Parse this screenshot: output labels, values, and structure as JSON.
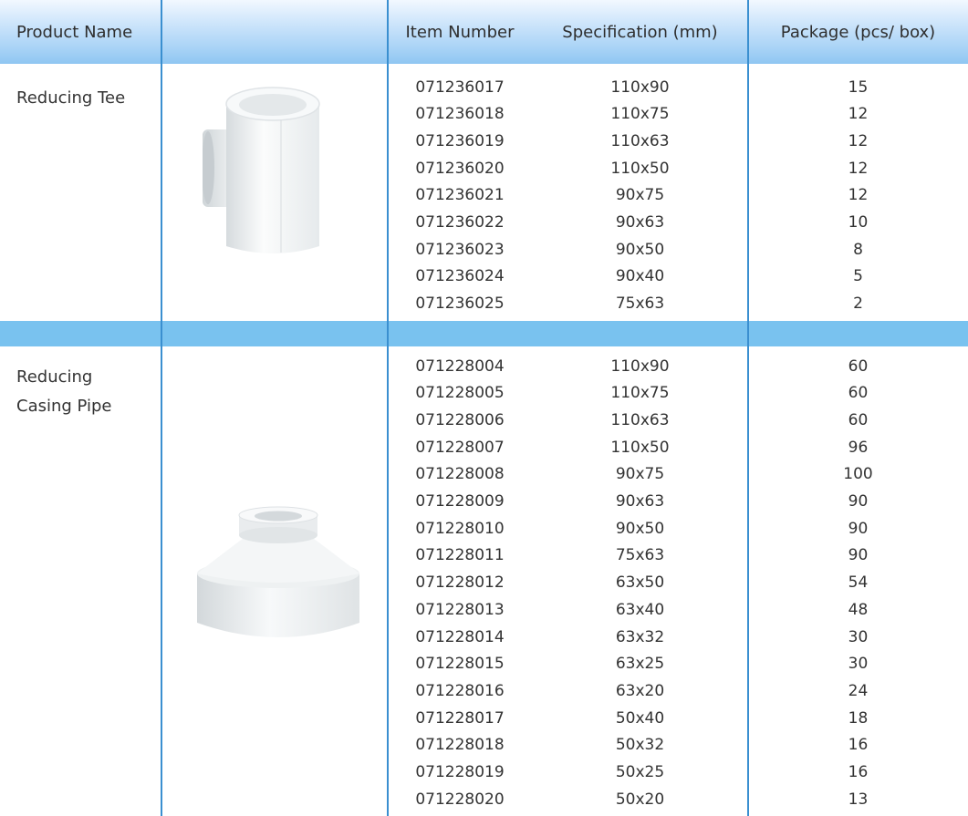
{
  "header": {
    "product_name": "Product Name",
    "item_number": "Item Number",
    "specification": "Specification (mm)",
    "package": "Package (pcs/ box)"
  },
  "groups": [
    {
      "name_lines": [
        "Reducing Tee"
      ],
      "image_icon": "reducing-tee-image",
      "rows": [
        {
          "item": "071236017",
          "spec": "110x90",
          "pkg": "15"
        },
        {
          "item": "071236018",
          "spec": "110x75",
          "pkg": "12"
        },
        {
          "item": "071236019",
          "spec": "110x63",
          "pkg": "12"
        },
        {
          "item": "071236020",
          "spec": "110x50",
          "pkg": "12"
        },
        {
          "item": "071236021",
          "spec": "90x75",
          "pkg": "12"
        },
        {
          "item": "071236022",
          "spec": "90x63",
          "pkg": "10"
        },
        {
          "item": "071236023",
          "spec": "90x50",
          "pkg": "8"
        },
        {
          "item": "071236024",
          "spec": "90x40",
          "pkg": "5"
        },
        {
          "item": "071236025",
          "spec": "75x63",
          "pkg": "2"
        }
      ]
    },
    {
      "name_lines": [
        "Reducing",
        "Casing Pipe"
      ],
      "image_icon": "reducing-casing-pipe-image",
      "rows": [
        {
          "item": "071228004",
          "spec": "110x90",
          "pkg": "60"
        },
        {
          "item": "071228005",
          "spec": "110x75",
          "pkg": "60"
        },
        {
          "item": "071228006",
          "spec": "110x63",
          "pkg": "60"
        },
        {
          "item": "071228007",
          "spec": "110x50",
          "pkg": "96"
        },
        {
          "item": "071228008",
          "spec": "90x75",
          "pkg": "100"
        },
        {
          "item": "071228009",
          "spec": "90x63",
          "pkg": "90"
        },
        {
          "item": "071228010",
          "spec": "90x50",
          "pkg": "90"
        },
        {
          "item": "071228011",
          "spec": "75x63",
          "pkg": "90"
        },
        {
          "item": "071228012",
          "spec": "63x50",
          "pkg": "54"
        },
        {
          "item": "071228013",
          "spec": "63x40",
          "pkg": "48"
        },
        {
          "item": "071228014",
          "spec": "63x32",
          "pkg": "30"
        },
        {
          "item": "071228015",
          "spec": "63x25",
          "pkg": "30"
        },
        {
          "item": "071228016",
          "spec": "63x20",
          "pkg": "24"
        },
        {
          "item": "071228017",
          "spec": "50x40",
          "pkg": "18"
        },
        {
          "item": "071228018",
          "spec": "50x32",
          "pkg": "16"
        },
        {
          "item": "071228019",
          "spec": "50x25",
          "pkg": "16"
        },
        {
          "item": "071228020",
          "spec": "50x20",
          "pkg": "13"
        }
      ]
    }
  ],
  "colors": {
    "header_gradient_bottom": "#8fc6f2",
    "separator": "#79c2ef",
    "grid_line": "#3a8fd0",
    "text": "#333333"
  }
}
